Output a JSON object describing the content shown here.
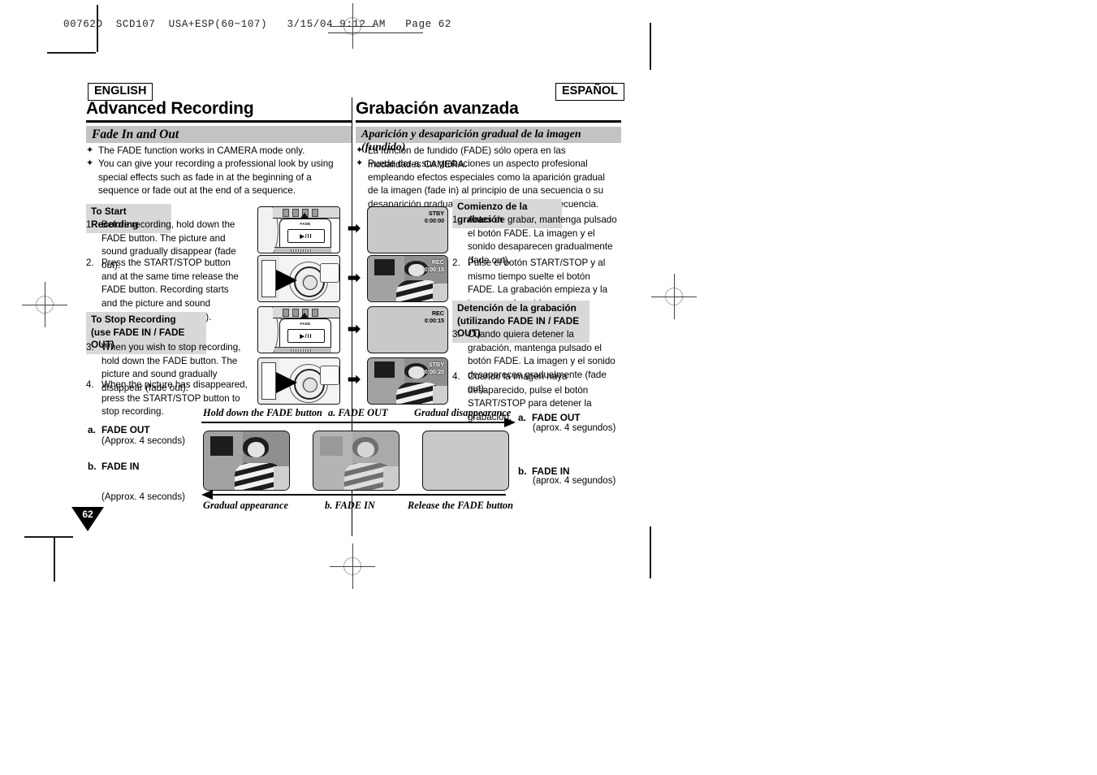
{
  "print_marks": {
    "proof_header": "00762D  SCD107  USA+ESP(60~107)   3/15/04 9:12 AM   Page 62"
  },
  "page": {
    "number": "62"
  },
  "left_column": {
    "language_tag": "ENGLISH",
    "title": "Advanced Recording",
    "section_heading": "Fade In and Out",
    "bullets": [
      "The FADE function works in CAMERA mode only.",
      "You can give your recording a professional look by using special effects such as fade in at the beginning of a sequence or fade out at the end of a sequence."
    ],
    "start_recording": {
      "heading": "To Start Recording",
      "steps": [
        {
          "num": "1.",
          "text": "Before recording, hold down the FADE button. The picture and sound gradually disappear (fade out)."
        },
        {
          "num": "2.",
          "text": "Press the START/STOP button and at the same time release the FADE button. Recording starts and the picture and sound gradually appear (fade in)."
        }
      ]
    },
    "stop_recording": {
      "heading_line1": "To Stop Recording",
      "heading_line2": "(use FADE IN / FADE OUT)",
      "steps": [
        {
          "num": "3.",
          "text": "When you wish to stop recording, hold down the FADE button. The picture and sound gradually disappear (fade out)."
        },
        {
          "num": "4.",
          "text": "When the picture has disappeared, press the START/STOP button to stop recording."
        }
      ]
    },
    "fade_legend": [
      {
        "key": "a.",
        "label": "FADE OUT",
        "note": "(Approx. 4 seconds)"
      },
      {
        "key": "b.",
        "label": "FADE IN",
        "note": "(Approx. 4 seconds)"
      }
    ]
  },
  "right_column": {
    "language_tag": "ESPAÑOL",
    "title": "Grabación avanzada",
    "section_heading": "Aparición y desaparición gradual de la imagen (fundido)",
    "bullets": [
      "La función de fundido (FADE) sólo opera en las modalidades CAMERA.",
      "Puede dar a sus grabaciones un aspecto profesional empleando efectos especiales como la aparición gradual de la imagen (fade in) al principio de una secuencia o su desaparición gradual (fade out) al final de la secuencia."
    ],
    "start_recording": {
      "heading": "Comienzo de la grabación",
      "steps": [
        {
          "num": "1.",
          "text": "Antes de grabar, mantenga pulsado el botón FADE. La imagen y el sonido desaparecen gradualmente (fade out)."
        },
        {
          "num": "2.",
          "text": "Pulse el botón START/STOP y al mismo tiempo suelte el botón FADE. La grabación empieza y la imagen y el sonido aparecen gradualmente (fade in)."
        }
      ]
    },
    "stop_recording": {
      "heading_line1": "Detención de la grabación",
      "heading_line2": "(utilizando FADE IN / FADE OUT)",
      "steps": [
        {
          "num": "3.",
          "text": "Cuando quiera detener la grabación, mantenga pulsado el botón FADE. La imagen y el sonido desaparecen gradualmente (fade out)."
        },
        {
          "num": "4.",
          "text": "Cuando la imagen haya desaparecido, pulse el botón START/STOP para detener la grabación."
        }
      ]
    },
    "fade_legend": [
      {
        "key": "a.",
        "label": "FADE OUT",
        "note": "(aprox. 4 segundos)"
      },
      {
        "key": "b.",
        "label": "FADE IN",
        "note": "(aprox. 4 segundos)"
      }
    ]
  },
  "illustrations": {
    "camcorder_fade_button_label": "FADE",
    "camcorder_fade_key_glyph": "▶/II",
    "step_arrow_glyph": "➡",
    "lcd_screens": [
      {
        "status": "STBY",
        "timecode": "0:00:00",
        "has_image": false
      },
      {
        "status": "REC",
        "timecode": "0:00:15",
        "has_image": true
      },
      {
        "status": "REC",
        "timecode": "0:00:15",
        "has_image": false
      },
      {
        "status": "STBY",
        "timecode": "0:00:20",
        "has_image": true
      }
    ],
    "top_flow_captions": [
      "Hold down the FADE button",
      "a. FADE OUT",
      "Gradual disappearance"
    ],
    "bottom_flow_captions": [
      "Gradual appearance",
      "b. FADE IN",
      "Release the FADE button"
    ]
  }
}
